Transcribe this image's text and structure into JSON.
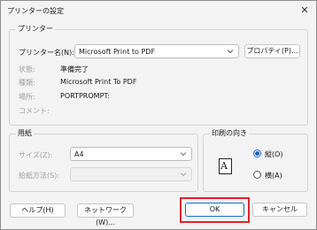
{
  "window": {
    "title": "プリンターの設定",
    "close": "✕"
  },
  "printer_group": {
    "label": "プリンター",
    "name_label": "プリンター名(N):",
    "name_value": "Microsoft Print to PDF",
    "properties_button": "プロパティ(P)...",
    "status_label": "状態:",
    "status_value": "準備完了",
    "type_label": "種類:",
    "type_value": "Microsoft Print To PDF",
    "where_label": "場所:",
    "where_value": "PORTPROMPT:",
    "comment_label": "コメント:"
  },
  "paper_group": {
    "label": "用紙",
    "size_label": "サイズ(Z):",
    "size_value": "A4",
    "source_label": "給紙方法(S):",
    "source_value": ""
  },
  "orientation_group": {
    "label": "印刷の向き",
    "icon_letter": "A",
    "portrait_label": "縦(O)",
    "landscape_label": "横(A)",
    "selected": "portrait"
  },
  "buttons": {
    "help": "ヘルプ(H)",
    "network": "ネットワーク(W)...",
    "ok": "OK",
    "cancel": "キャンセル"
  },
  "colors": {
    "highlight": "#d9262c",
    "accent": "#1d5fbf"
  }
}
